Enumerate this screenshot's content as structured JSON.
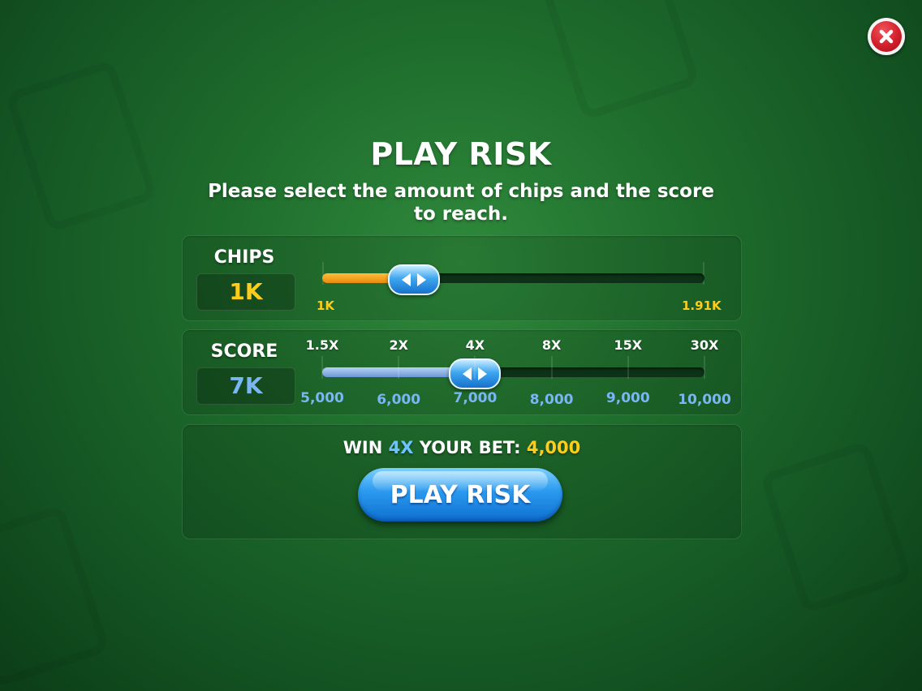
{
  "dialog": {
    "title": "PLAY RISK",
    "subtitle": "Please select the amount of chips and the score to reach."
  },
  "icons": {
    "close": "close-icon",
    "slider_handle": "left-right-arrows-icon"
  },
  "colors": {
    "background": "#1f6e2d",
    "chips_accent": "#ffcc1a",
    "score_accent": "#79b6f2",
    "multiplier_accent": "#6cc4ff",
    "chips_fill": "#f0a020",
    "score_fill": "#8fb2e6",
    "button": "#2c9bf0",
    "close_button": "#d11f2a"
  },
  "chips": {
    "label": "CHIPS",
    "value": "1K",
    "slider": {
      "min_label": "1K",
      "max_label": "1.91K",
      "position_fraction": 0.24
    }
  },
  "score": {
    "label": "SCORE",
    "value": "7K",
    "slider": {
      "selected_index": 2,
      "multipliers": [
        "1.5X",
        "2X",
        "4X",
        "8X",
        "15X",
        "30X"
      ],
      "values": [
        "5,000",
        "6,000",
        "7,000",
        "8,000",
        "9,000",
        "10,000"
      ]
    }
  },
  "bet": {
    "prefix": "WIN",
    "multiplier": "4X",
    "middle": "YOUR BET:",
    "amount": "4,000",
    "button_label": "PLAY RISK"
  }
}
